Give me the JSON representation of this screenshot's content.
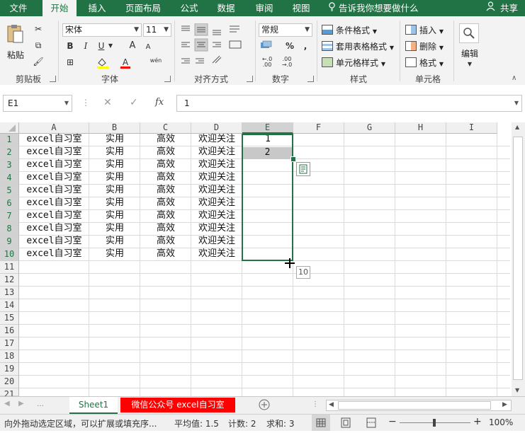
{
  "ribbon": {
    "tabs": [
      "文件",
      "开始",
      "插入",
      "页面布局",
      "公式",
      "数据",
      "审阅",
      "视图"
    ],
    "active_tab": "开始",
    "tell_me": "告诉我你想要做什么",
    "share": "共享",
    "clipboard": {
      "paste": "粘贴",
      "group": "剪贴板"
    },
    "font": {
      "name": "宋体",
      "size": "11",
      "group": "字体",
      "bold": "B",
      "italic": "I",
      "underline": "U",
      "grow": "A",
      "shrink": "A",
      "color_a": "A",
      "phonetic": "wén"
    },
    "alignment": {
      "group": "对齐方式"
    },
    "number": {
      "format": "常规",
      "group": "数字",
      "percent": "%",
      "comma": ","
    },
    "styles": {
      "conditional": "条件格式",
      "table": "套用表格格式",
      "cell": "单元格样式",
      "group": "样式"
    },
    "cells": {
      "insert": "插入",
      "delete": "删除",
      "format": "格式",
      "group": "单元格"
    },
    "editing": {
      "label": "编辑"
    }
  },
  "formula_bar": {
    "name_box": "E1",
    "value": "1",
    "fx": "fx",
    "cancel": "✕",
    "enter": "✓"
  },
  "grid": {
    "columns": [
      "A",
      "B",
      "C",
      "D",
      "E",
      "F",
      "G",
      "H",
      "I"
    ],
    "rows": [
      "1",
      "2",
      "3",
      "4",
      "5",
      "6",
      "7",
      "8",
      "9",
      "10",
      "11",
      "12",
      "13",
      "14",
      "15",
      "16",
      "17",
      "18",
      "19",
      "20",
      "21"
    ],
    "data": [
      [
        "excel自习室",
        "实用",
        "高效",
        "欢迎关注",
        "1"
      ],
      [
        "excel自习室",
        "实用",
        "高效",
        "欢迎关注",
        "2"
      ],
      [
        "excel自习室",
        "实用",
        "高效",
        "欢迎关注",
        ""
      ],
      [
        "excel自习室",
        "实用",
        "高效",
        "欢迎关注",
        ""
      ],
      [
        "excel自习室",
        "实用",
        "高效",
        "欢迎关注",
        ""
      ],
      [
        "excel自习室",
        "实用",
        "高效",
        "欢迎关注",
        ""
      ],
      [
        "excel自习室",
        "实用",
        "高效",
        "欢迎关注",
        ""
      ],
      [
        "excel自习室",
        "实用",
        "高效",
        "欢迎关注",
        ""
      ],
      [
        "excel自习室",
        "实用",
        "高效",
        "欢迎关注",
        ""
      ],
      [
        "excel自习室",
        "实用",
        "高效",
        "欢迎关注",
        ""
      ]
    ],
    "fill_tooltip": "10"
  },
  "sheets": {
    "tabs": [
      "Sheet1",
      "微信公众号 excel自习室"
    ],
    "active": "Sheet1"
  },
  "status": {
    "message": "向外拖动选定区域，可以扩展或填充序...",
    "average": "平均值: 1.5",
    "count": "计数: 2",
    "sum": "求和: 3",
    "zoom": "100%"
  },
  "colors": {
    "excel_green": "#217346",
    "selection_green": "#217346",
    "sheet_red": "#ff0000"
  }
}
